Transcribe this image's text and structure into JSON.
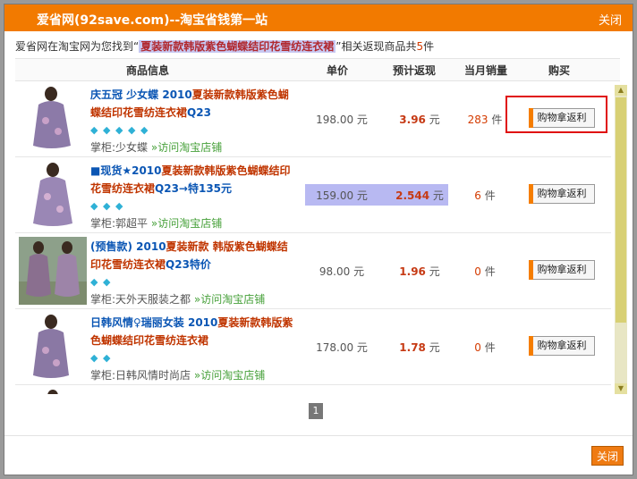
{
  "dialog": {
    "title": "爱省网(92save.com)--淘宝省钱第一站",
    "close_label": "关闭"
  },
  "summary": {
    "prefix": "爱省网在淘宝网为您找到“",
    "keyword": "夏装新款韩版紫色蝴蝶结印花雪纺连衣裙",
    "middle": "”相关返现商品共",
    "count": "5",
    "suffix": "件"
  },
  "table": {
    "col_info": "商品信息",
    "col_price": "单价",
    "col_rebate": "预计返现",
    "col_sales": "当月销量",
    "col_buy": "购买"
  },
  "items": [
    {
      "title_pre": "庆五冠 少女蝶 2010",
      "title_kw": "夏装新款韩版紫色蝴蝶结印花雪纺连衣裙",
      "title_post": "Q23",
      "diamonds": 5,
      "seller_label": "掌柜:少女蝶",
      "visit": "»访问淘宝店铺",
      "price": "198.00 元",
      "rebate": "3.96",
      "rebate_unit": " 元",
      "sales": "283",
      "sales_unit": " 件",
      "buy": "购物拿返利"
    },
    {
      "title_pre": "■现货★2010",
      "title_kw": "夏装新款韩版紫色蝴蝶结印花雪纺连衣裙",
      "title_post": "Q23→特135元",
      "diamonds": 3,
      "seller_label": "掌柜:郭超平",
      "visit": "»访问淘宝店铺",
      "price": "159.00 元",
      "rebate": "2.544",
      "rebate_unit": " 元",
      "sales": "6",
      "sales_unit": " 件",
      "buy": "购物拿返利"
    },
    {
      "title_pre": "(预售款) 2010",
      "title_kw": "夏装新款 韩版紫色蝴蝶结印花雪纺连衣裙",
      "title_post": "Q23特价",
      "diamonds": 2,
      "seller_label": "掌柜:天外天服装之都",
      "visit": "»访问淘宝店铺",
      "price": "98.00 元",
      "rebate": "1.96",
      "rebate_unit": " 元",
      "sales": "0",
      "sales_unit": " 件",
      "buy": "购物拿返利"
    },
    {
      "title_pre": "日韩风情♀瑞丽女装 2010",
      "title_kw": "夏装新款韩版紫色蝴蝶结印花雪纺连衣裙",
      "title_post": "",
      "diamonds": 2,
      "seller_label": "掌柜:日韩风情时尚店",
      "visit": "»访问淘宝店铺",
      "price": "178.00 元",
      "rebate": "1.78",
      "rebate_unit": " 元",
      "sales": "0",
      "sales_unit": " 件",
      "buy": "购物拿返利"
    }
  ],
  "pager": {
    "current": "1"
  },
  "footer": {
    "close_label": "关闭"
  },
  "colors": {
    "accent": "#f27a00",
    "highlight": "#b8b9f2",
    "red_box": "#e01010"
  },
  "icons": {
    "diamond": "diamond-icon",
    "buy": "cart-button"
  }
}
